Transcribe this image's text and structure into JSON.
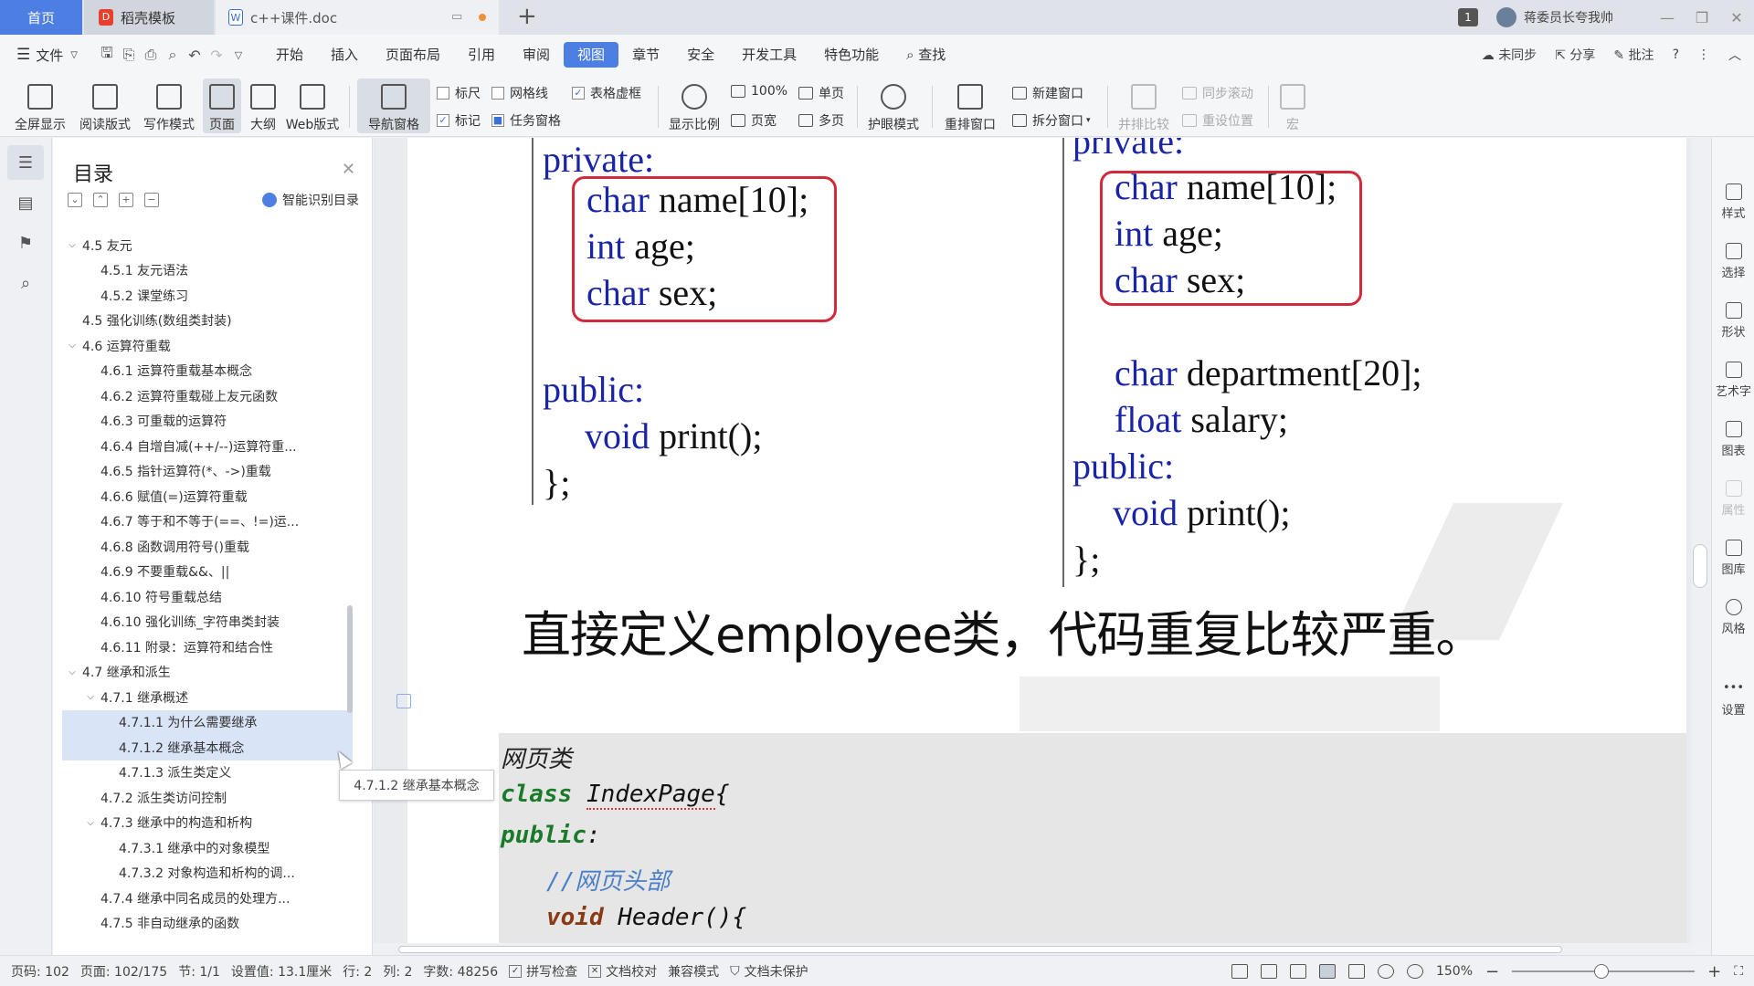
{
  "tabs": {
    "home": "首页",
    "daoke": "稻壳模板",
    "doc": "c++课件.doc",
    "badge": "1",
    "user": "蒋委员长夸我帅"
  },
  "menu": {
    "file": "文件",
    "items": [
      "开始",
      "插入",
      "页面布局",
      "引用",
      "审阅",
      "视图",
      "章节",
      "安全",
      "开发工具",
      "特色功能"
    ],
    "active": "视图",
    "search": "查找",
    "sync": "未同步",
    "share": "分享",
    "annotate": "批注"
  },
  "ribbon": {
    "fullscreen": "全屏显示",
    "reading": "阅读版式",
    "writing": "写作模式",
    "page": "页面",
    "outline": "大纲",
    "web": "Web版式",
    "nav_pane": "导航窗格",
    "ruler": "标尺",
    "gridlines": "网格线",
    "table_grid": "表格虚框",
    "marks": "标记",
    "task_pane": "任务窗格",
    "zoom_ratio": "显示比例",
    "zoom_100": "100%",
    "page_width": "页宽",
    "single_page": "单页",
    "multi_page": "多页",
    "eye_mode": "护眼模式",
    "rearrange": "重排窗口",
    "new_window": "新建窗口",
    "split_window": "拆分窗口",
    "side_by_side": "并排比较",
    "sync_scroll": "同步滚动",
    "reset_pos": "重设位置",
    "macro": "宏"
  },
  "nav": {
    "title": "目录",
    "smart": "智能识别目录",
    "toc": [
      {
        "text": "4.5 友元",
        "level": 1,
        "arrow": true
      },
      {
        "text": "4.5.1 友元语法",
        "level": 2
      },
      {
        "text": "4.5.2 课堂练习",
        "level": 2
      },
      {
        "text": "4.5 强化训练(数组类封装)",
        "level": 1
      },
      {
        "text": "4.6 运算符重载",
        "level": 1,
        "arrow": true
      },
      {
        "text": "4.6.1 运算符重载基本概念",
        "level": 2
      },
      {
        "text": "4.6.2 运算符重载碰上友元函数",
        "level": 2
      },
      {
        "text": "4.6.3 可重载的运算符",
        "level": 2
      },
      {
        "text": "4.6.4 自增自减(++/--)运算符重...",
        "level": 2
      },
      {
        "text": "4.6.5 指针运算符(*、->)重载",
        "level": 2
      },
      {
        "text": "4.6.6 赋值(=)运算符重载",
        "level": 2
      },
      {
        "text": "4.6.7 等于和不等于(==、!=)运...",
        "level": 2
      },
      {
        "text": "4.6.8 函数调用符号()重载",
        "level": 2
      },
      {
        "text": "4.6.9 不要重载&&、||",
        "level": 2
      },
      {
        "text": "4.6.10 符号重载总结",
        "level": 2
      },
      {
        "text": "4.6.10 强化训练_字符串类封装",
        "level": 2
      },
      {
        "text": "4.6.11 附录：运算符和结合性",
        "level": 2
      },
      {
        "text": "4.7 继承和派生",
        "level": 1,
        "arrow": true
      },
      {
        "text": "4.7.1 继承概述",
        "level": 2,
        "arrow": true
      },
      {
        "text": "4.7.1.1 为什么需要继承",
        "level": 3,
        "hl": true
      },
      {
        "text": "4.7.1.2 继承基本概念",
        "level": 3,
        "hl": true
      },
      {
        "text": "4.7.1.3 派生类定义",
        "level": 3
      },
      {
        "text": "4.7.2 派生类访问控制",
        "level": 2
      },
      {
        "text": "4.7.3 继承中的构造和析构",
        "level": 2,
        "arrow": true
      },
      {
        "text": "4.7.3.1 继承中的对象模型",
        "level": 3
      },
      {
        "text": "4.7.3.2 对象构造和析构的调...",
        "level": 3
      },
      {
        "text": "4.7.4 继承中同名成员的处理方...",
        "level": 2
      },
      {
        "text": "4.7.5 非自动继承的函数",
        "level": 2
      }
    ],
    "tooltip": "4.7.1.2 继承基本概念"
  },
  "doc": {
    "left": {
      "private": "private:",
      "name": [
        "char",
        " name[10];"
      ],
      "age": [
        "int",
        " age;"
      ],
      "sex": [
        "char",
        " sex;"
      ],
      "public": "public:",
      "print": [
        "void",
        " print();"
      ],
      "close": "};"
    },
    "right": {
      "private": "private:",
      "name": [
        "char",
        " name[10];"
      ],
      "age": [
        "int",
        " age;"
      ],
      "sex": [
        "char",
        " sex;"
      ],
      "dept": [
        "char",
        " department[20];"
      ],
      "salary": [
        "float",
        " salary;"
      ],
      "public": "public:",
      "print": [
        "void",
        " print();"
      ],
      "close": "};"
    },
    "heading": "直接定义employee类，代码重复比较严重。",
    "code2": {
      "title": "网页类",
      "class_kw": "class",
      "class_name": "IndexPage",
      "class_brace": "{",
      "public": "public",
      "colon": ":",
      "comment": "//网页头部",
      "void_kw": "void",
      "func": "Header(){"
    }
  },
  "right_rail": {
    "style": "样式",
    "select": "选择",
    "shape": "形状",
    "art": "艺术字",
    "chart": "图表",
    "property": "属性",
    "gallery": "图库",
    "theme": "风格",
    "settings": "设置"
  },
  "status": {
    "page_code": "页码: 102",
    "page": "页面: 102/175",
    "section": "节: 1/1",
    "setting": "设置值: 13.1厘米",
    "row": "行: 2",
    "col": "列: 2",
    "words": "字数: 48256",
    "spell": "拼写检查",
    "proof": "文档校对",
    "compat": "兼容模式",
    "protect": "文档未保护",
    "zoom": "150%"
  }
}
